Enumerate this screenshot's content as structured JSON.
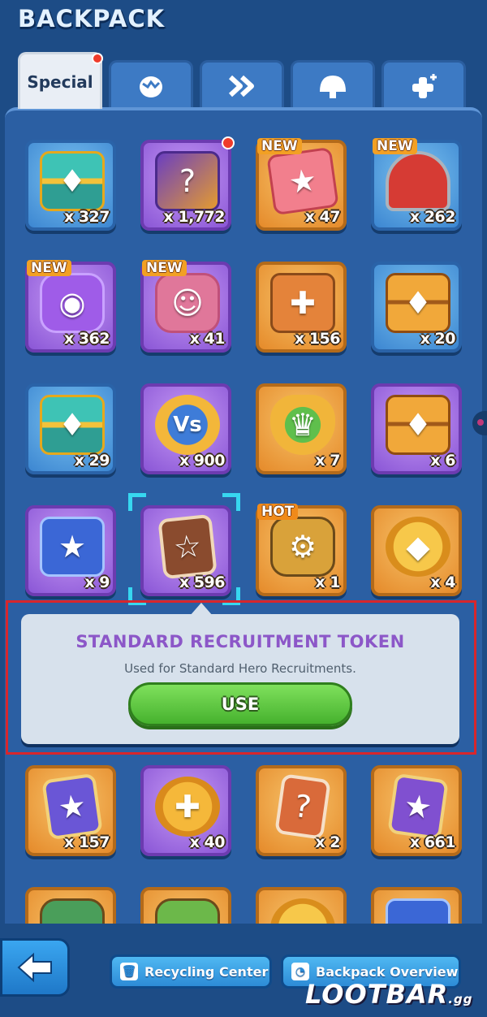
{
  "title": "BACKPACK",
  "tabs": [
    {
      "label": "Special",
      "active": true,
      "icon": "",
      "notification": true
    },
    {
      "label": "",
      "icon": "egg-icon"
    },
    {
      "label": "",
      "icon": "double-chevron-icon"
    },
    {
      "label": "",
      "icon": "helmet-icon"
    },
    {
      "label": "",
      "icon": "plus-cross-icon"
    }
  ],
  "items": [
    {
      "qty": "x 327",
      "icon": "teal-chest-icon",
      "badge": ""
    },
    {
      "qty": "x 1,772",
      "icon": "mystery-box-icon",
      "badge": "",
      "dot": true
    },
    {
      "qty": "x 47",
      "icon": "star-ticket-icon",
      "badge": "NEW"
    },
    {
      "qty": "x 262",
      "icon": "drum-icon",
      "badge": "NEW"
    },
    {
      "qty": "x 362",
      "icon": "puzzle-piece-icon",
      "badge": "NEW"
    },
    {
      "qty": "x 41",
      "icon": "hero-puzzle-icon",
      "badge": "NEW"
    },
    {
      "qty": "x 156",
      "icon": "crate-icon",
      "badge": ""
    },
    {
      "qty": "x 20",
      "icon": "orange-chest-icon",
      "badge": ""
    },
    {
      "qty": "x 29",
      "icon": "teal-chest-icon",
      "badge": ""
    },
    {
      "qty": "x 900",
      "icon": "vs-medal-icon",
      "badge": ""
    },
    {
      "qty": "x 7",
      "icon": "crown-badge-icon",
      "badge": ""
    },
    {
      "qty": "x 6",
      "icon": "orange-chest-icon",
      "badge": ""
    },
    {
      "qty": "x 9",
      "icon": "blue-star-box-icon",
      "badge": ""
    },
    {
      "qty": "x 596",
      "icon": "recruitment-card-icon",
      "badge": "",
      "selected": true
    },
    {
      "qty": "x 1",
      "icon": "mech-icon",
      "badge": "HOT"
    },
    {
      "qty": "x 4",
      "icon": "gold-coin-icon",
      "badge": ""
    },
    {
      "qty": "x 157",
      "icon": "star-card-icon",
      "badge": ""
    },
    {
      "qty": "x 40",
      "icon": "gamepad-coin-icon",
      "badge": ""
    },
    {
      "qty": "x 2",
      "icon": "mystery-card-icon",
      "badge": ""
    },
    {
      "qty": "x 661",
      "icon": "purple-star-card-icon",
      "badge": ""
    }
  ],
  "tooltip": {
    "title": "STANDARD RECRUITMENT TOKEN",
    "description": "Used for Standard Hero Recruitments.",
    "button": "USE"
  },
  "bottom": {
    "recycling": "Recycling Center",
    "overview": "Backpack Overview"
  },
  "watermark": {
    "main": "LOOTBAR",
    "suffix": ".gg"
  },
  "colors": {
    "accent": "#8c57c8",
    "use_button": "#46b22e",
    "highlight": "#d8262c"
  }
}
